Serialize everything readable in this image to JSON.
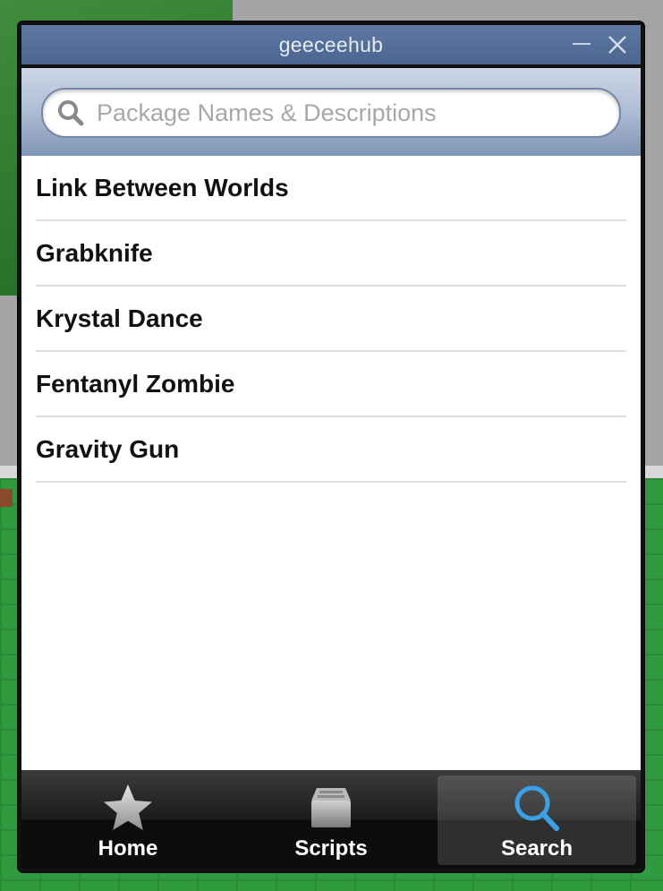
{
  "window": {
    "title": "geeceehub"
  },
  "search": {
    "placeholder": "Package Names & Descriptions",
    "value": ""
  },
  "results": [
    {
      "label": "Link Between Worlds"
    },
    {
      "label": "Grabknife"
    },
    {
      "label": "Krystal Dance"
    },
    {
      "label": "Fentanyl Zombie"
    },
    {
      "label": "Gravity Gun"
    }
  ],
  "tabs": [
    {
      "label": "Home",
      "icon": "star-icon",
      "active": false
    },
    {
      "label": "Scripts",
      "icon": "box-icon",
      "active": false
    },
    {
      "label": "Search",
      "icon": "magnifier-icon",
      "active": true
    }
  ],
  "colors": {
    "accent": "#3aa0e8",
    "titlebar": "#5470a0"
  }
}
